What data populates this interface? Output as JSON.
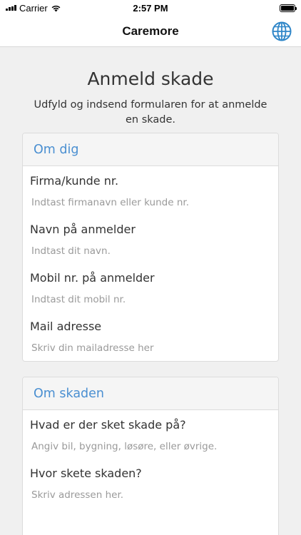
{
  "status_bar": {
    "carrier": "Carrier",
    "time": "2:57 PM"
  },
  "navbar": {
    "title": "Caremore",
    "language_icon": "globe-icon"
  },
  "page": {
    "title": "Anmeld skade",
    "subtitle": "Udfyld og indsend formularen for at anmelde en skade."
  },
  "section_about_you": {
    "header": "Om dig",
    "fields": [
      {
        "label": "Firma/kunde nr.",
        "placeholder": "Indtast firmanavn eller kunde nr."
      },
      {
        "label": "Navn på anmelder",
        "placeholder": "Indtast dit navn."
      },
      {
        "label": "Mobil nr. på anmelder",
        "placeholder": "Indtast dit mobil nr."
      },
      {
        "label": "Mail adresse",
        "placeholder": "Skriv din mailadresse her"
      }
    ]
  },
  "section_damage": {
    "header": "Om skaden",
    "fields": [
      {
        "label": "Hvad er der sket skade på?",
        "placeholder": "Angiv bil, bygning, løsøre, eller øvrige."
      },
      {
        "label": "Hvor skete skaden?",
        "placeholder": "Skriv adressen her."
      }
    ]
  },
  "colors": {
    "accent": "#4a8fd1",
    "background": "#f0f0f0"
  }
}
